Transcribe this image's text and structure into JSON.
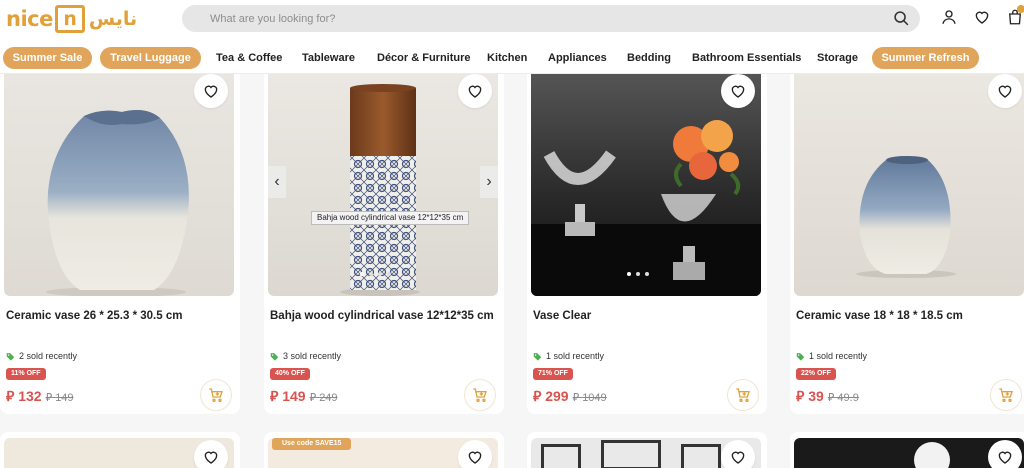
{
  "header": {
    "logo_latin": "nice",
    "logo_box_letter": "n",
    "logo_arabic": "نايس",
    "search_placeholder": "What are you looking for?",
    "icons": [
      "search-icon",
      "user-icon",
      "heart-icon",
      "bag-icon"
    ]
  },
  "nav": {
    "items": [
      {
        "label": "Summer Sale",
        "pill": true
      },
      {
        "label": "Travel Luggage",
        "pill": true
      },
      {
        "label": "Tea & Coffee",
        "pill": false
      },
      {
        "label": "Tableware",
        "pill": false
      },
      {
        "label": "Décor & Furniture",
        "pill": false
      },
      {
        "label": "Kitchen",
        "pill": false
      },
      {
        "label": "Appliances",
        "pill": false
      },
      {
        "label": "Bedding",
        "pill": false
      },
      {
        "label": "Bathroom Essentials",
        "pill": false
      },
      {
        "label": "Storage",
        "pill": false
      },
      {
        "label": "Summer Refresh",
        "pill": true
      }
    ]
  },
  "products": [
    {
      "title": "Ceramic vase 26 * 25.3 * 30.5 cm",
      "sold": "2 sold recently",
      "discount": "11% OFF",
      "currency": "⃁",
      "price": "132",
      "old_price": "149"
    },
    {
      "title": "Bahja wood cylindrical vase 12*12*35 cm",
      "sold": "3 sold recently",
      "discount": "40% OFF",
      "currency": "⃁",
      "price": "149",
      "old_price": "249",
      "tooltip": "Bahja wood cylindrical vase 12*12*35 cm"
    },
    {
      "title": "Vase Clear",
      "sold": "1 sold recently",
      "discount": "71% OFF",
      "currency": "⃁",
      "price": "299",
      "old_price": "1049"
    },
    {
      "title": "Ceramic vase 18 * 18 * 18.5 cm",
      "sold": "1 sold recently",
      "discount": "22% OFF",
      "currency": "⃁",
      "price": "39",
      "old_price": "49.9"
    }
  ],
  "second_row": {
    "code_tag": "Use code SAVE15"
  },
  "colors": {
    "brand": "#e0a03a",
    "pill": "#e0a55a",
    "discount": "#d9534f",
    "sold_tag": "#4caf50"
  }
}
